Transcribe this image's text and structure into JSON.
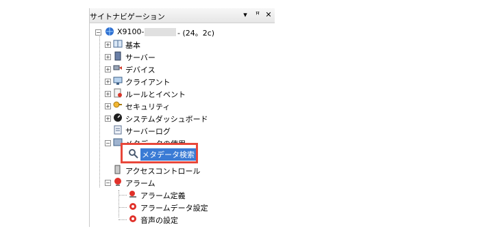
{
  "panel": {
    "title": "サイトナビゲーション",
    "buttons": {
      "dropdown": "▾",
      "pin": "ꟸ",
      "close": "✕"
    }
  },
  "tree": {
    "root_label": "X9100-",
    "root_suffix": "- (24。2c)",
    "items": [
      {
        "label": "基本"
      },
      {
        "label": "サーバー"
      },
      {
        "label": "デバイス"
      },
      {
        "label": "クライアント"
      },
      {
        "label": "ルールとイベント"
      },
      {
        "label": "セキュリティ"
      },
      {
        "label": "システムダッシュボード"
      },
      {
        "label": "サーバーログ"
      },
      {
        "label": "メタデータの使用"
      },
      {
        "label": "アクセスコントロール"
      },
      {
        "label": "アラーム"
      },
      {
        "label": "アラーム定義"
      },
      {
        "label": "アラームデータ設定"
      },
      {
        "label": "音声の設定"
      }
    ]
  },
  "popup": {
    "label": "メタデータ検索"
  },
  "colors": {
    "highlight_border": "#e8473a",
    "selection": "#3a7bd5"
  }
}
